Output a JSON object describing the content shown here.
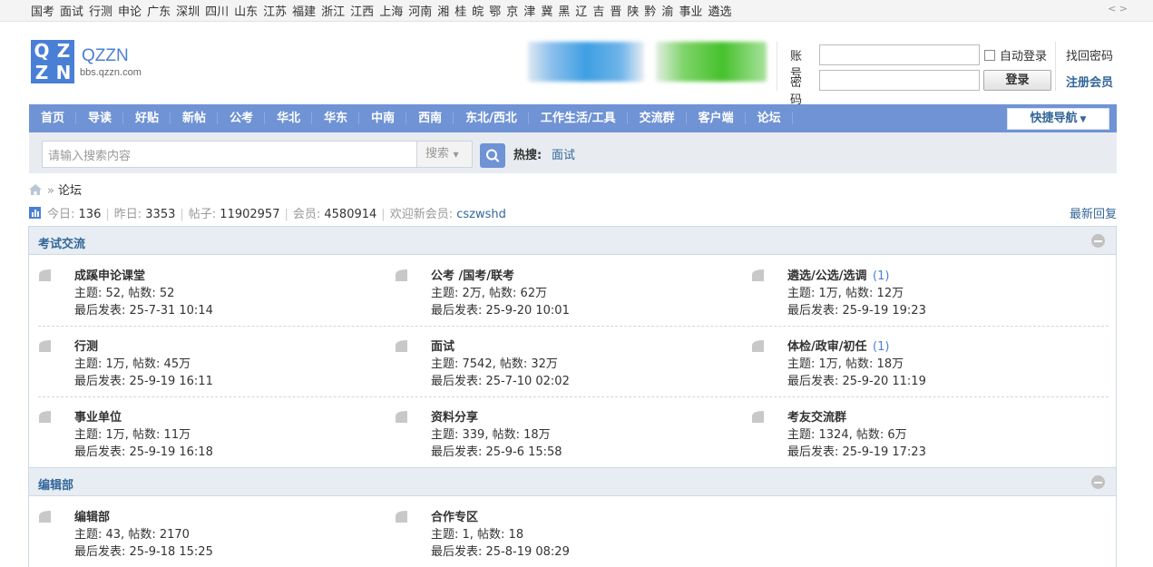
{
  "regions": [
    "国考",
    "面试",
    "行测",
    "申论",
    "广东",
    "深圳",
    "四川",
    "山东",
    "江苏",
    "福建",
    "浙江",
    "江西",
    "上海",
    "河南",
    "湘",
    "桂",
    "皖",
    "鄂",
    "京",
    "津",
    "冀",
    "黑",
    "辽",
    "吉",
    "晋",
    "陕",
    "黔",
    "渝",
    "事业",
    "遴选"
  ],
  "logo": {
    "letters": [
      "Q",
      "Z",
      "Z",
      "N"
    ],
    "name": "QZZN",
    "url": "bbs.qzzn.com"
  },
  "login": {
    "account_label": "账号",
    "password_label": "密码",
    "auto_login": "自动登录",
    "login_button": "登录",
    "find_password": "找回密码",
    "register": "注册会员"
  },
  "nav": {
    "items": [
      "首页",
      "导读",
      "好贴",
      "新帖",
      "公考",
      "华北",
      "华东",
      "中南",
      "西南",
      "东北/西北",
      "工作生活/工具",
      "交流群",
      "客户端",
      "论坛"
    ],
    "quick_nav": "快捷导航"
  },
  "search": {
    "placeholder": "请输入搜索内容",
    "type": "搜索",
    "hot_label": "热搜:",
    "hot_link": "面试"
  },
  "breadcrumb": {
    "current": "论坛"
  },
  "stats": {
    "today_label": "今日:",
    "today": "136",
    "yesterday_label": "昨日:",
    "yesterday": "3353",
    "posts_label": "帖子:",
    "posts": "11902957",
    "members_label": "会员:",
    "members": "4580914",
    "welcome_label": "欢迎新会员:",
    "newest_member": "cszwshd",
    "latest_reply": "最新回复"
  },
  "sections": [
    {
      "title": "考试交流",
      "forums": [
        {
          "name": "成蹊申论课堂",
          "today": "",
          "topics_line": "主题: 52, 帖数: 52",
          "last_line": "最后发表: 25-7-31 10:14"
        },
        {
          "name": "公考 /国考/联考",
          "today": "",
          "topics_line": "主题: 2万, 帖数: 62万",
          "last_line": "最后发表: 25-9-20 10:01"
        },
        {
          "name": "遴选/公选/选调",
          "today": "(1)",
          "topics_line": "主题: 1万, 帖数: 12万",
          "last_line": "最后发表: 25-9-19 19:23"
        },
        {
          "name": "行测",
          "today": "",
          "topics_line": "主题: 1万, 帖数: 45万",
          "last_line": "最后发表: 25-9-19 16:11"
        },
        {
          "name": "面试",
          "today": "",
          "topics_line": "主题: 7542, 帖数: 32万",
          "last_line": "最后发表: 25-7-10 02:02"
        },
        {
          "name": "体检/政审/初任",
          "today": "(1)",
          "topics_line": "主题: 1万, 帖数: 18万",
          "last_line": "最后发表: 25-9-20 11:19"
        },
        {
          "name": "事业单位",
          "today": "",
          "topics_line": "主题: 1万, 帖数: 11万",
          "last_line": "最后发表: 25-9-19 16:18"
        },
        {
          "name": "资料分享",
          "today": "",
          "topics_line": "主题: 339, 帖数: 18万",
          "last_line": "最后发表: 25-9-6 15:58"
        },
        {
          "name": "考友交流群",
          "today": "",
          "topics_line": "主题: 1324, 帖数: 6万",
          "last_line": "最后发表: 25-9-19 17:23"
        }
      ]
    },
    {
      "title": "编辑部",
      "forums": [
        {
          "name": "编辑部",
          "today": "",
          "topics_line": "主题: 43, 帖数: 2170",
          "last_line": "最后发表: 25-9-18 15:25"
        },
        {
          "name": "合作专区",
          "today": "",
          "topics_line": "主题: 1, 帖数: 18",
          "last_line": "最后发表: 25-8-19 08:29"
        }
      ]
    }
  ]
}
